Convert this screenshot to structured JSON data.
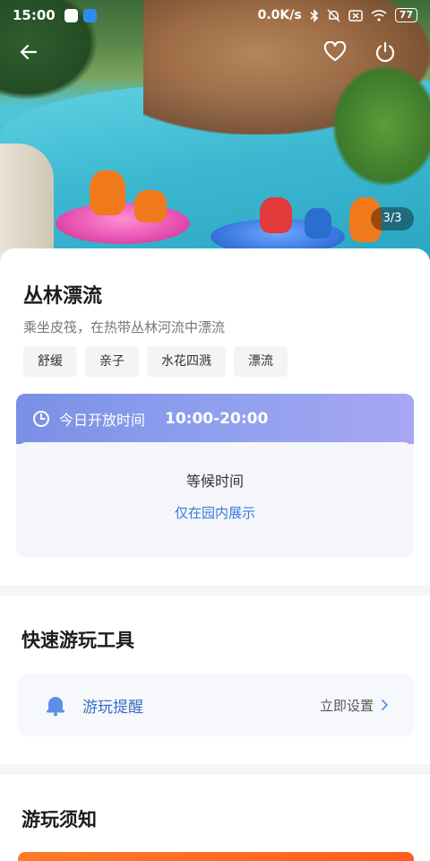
{
  "status_bar": {
    "time": "15:00",
    "network_speed": "0.0K/s",
    "battery": "77"
  },
  "hero": {
    "counter": "3/3"
  },
  "attraction": {
    "title": "丛林漂流",
    "subtitle": "乘坐皮筏，在热带丛林河流中漂流",
    "tags": [
      "舒缓",
      "亲子",
      "水花四溅",
      "漂流"
    ]
  },
  "hours": {
    "label": "今日开放时间",
    "value": "10:00-20:00",
    "wait_title": "等候时间",
    "wait_note": "仅在园内展示"
  },
  "quick_tools": {
    "title": "快速游玩工具",
    "reminder_label": "游玩提醒",
    "reminder_action": "立即设置"
  },
  "notice": {
    "title": "游玩须知"
  },
  "colors": {
    "accent_blue": "#3b6fc4",
    "hours_gradient_start": "#7a8fe6",
    "hours_gradient_end": "#a7a6f2",
    "orange": "#ff6a24"
  },
  "icons": {
    "back": "back-arrow-icon",
    "favorite": "heart-icon",
    "exit": "power-icon",
    "clock": "clock-icon",
    "bell": "bell-icon",
    "chevron": "chevron-right-icon"
  }
}
